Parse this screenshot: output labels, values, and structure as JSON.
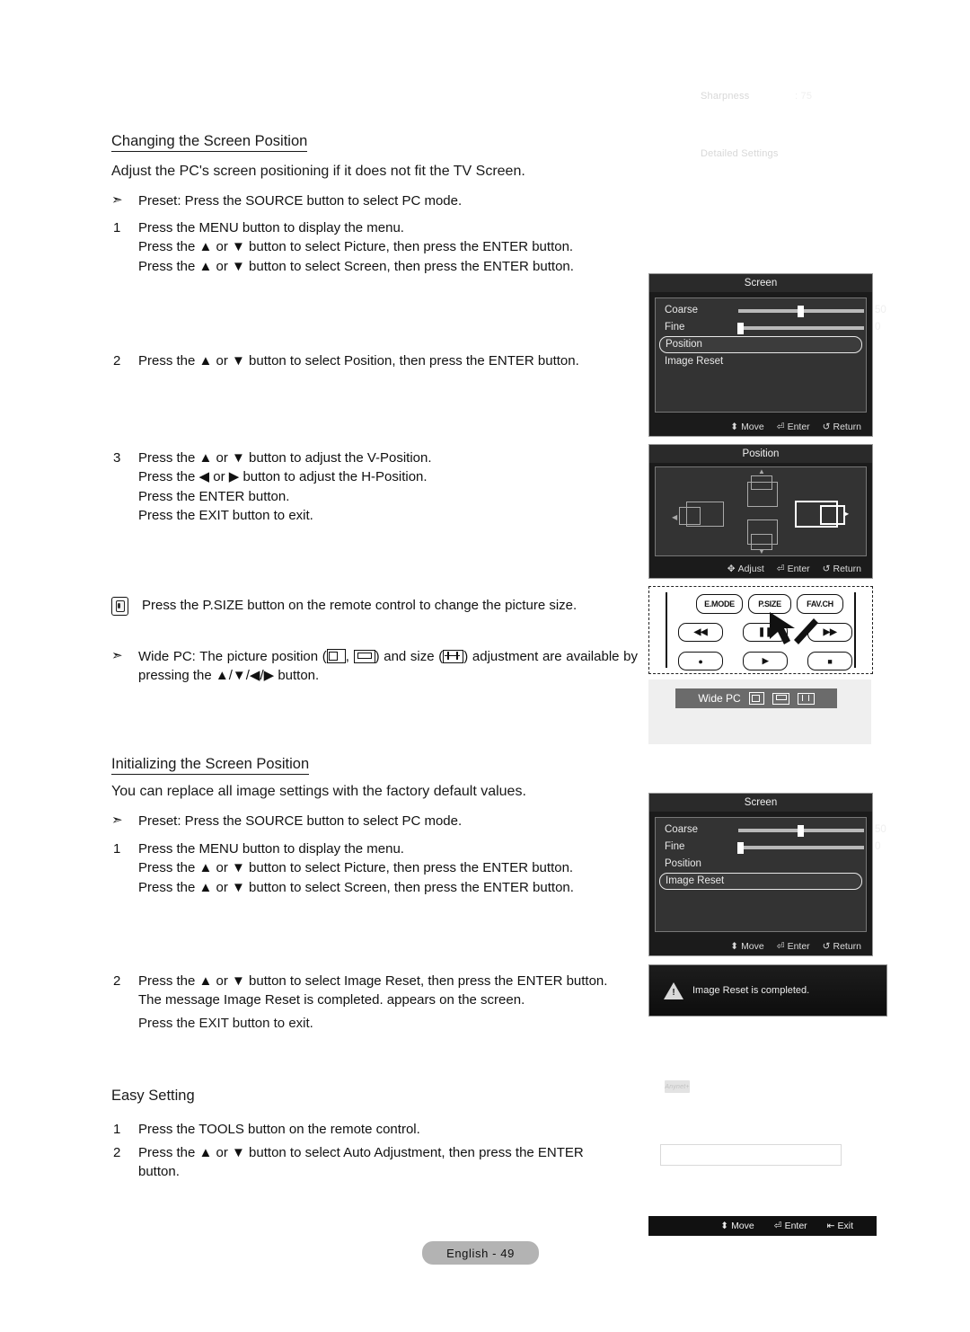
{
  "ghost": {
    "sharpness_label": "Sharpness",
    "sharpness_value": ": 75",
    "detailed_settings": "Detailed Settings",
    "anynet_badge": "Anynet+"
  },
  "section1": {
    "title": "Changing the Screen Position",
    "lead": "Adjust the PC's screen positioning if it does not fit the TV Screen.",
    "preset_bullet": "Preset: Press the SOURCE button to select PC mode.",
    "steps": [
      {
        "num": "1",
        "lines": [
          "Press the MENU button to display the menu.",
          "Press the ▲ or ▼ button to select Picture, then press the ENTER button.",
          "Press the ▲ or ▼ button to select Screen, then press the ENTER button."
        ]
      },
      {
        "num": "2",
        "lines": [
          "Press the ▲ or ▼ button to select Position, then press the ENTER button."
        ]
      },
      {
        "num": "3",
        "lines": [
          "Press the ▲ or ▼ button to adjust the V-Position.",
          "Press the ◀ or ▶ button to adjust the H-Position.",
          "Press the ENTER button.",
          "Press the EXIT button to exit."
        ]
      }
    ],
    "note": "Press the P.SIZE button on the remote control to change the picture size.",
    "widepc_bullet": {
      "part1": "Wide PC: The picture position (",
      "part2": ", ",
      "part3": ") and size (",
      "part4": ") adjustment are available by",
      "line2": "pressing the ▲/▼/◀/▶ button."
    }
  },
  "section2": {
    "title": "Initializing the Screen Position",
    "lead": "You can replace all image settings with the factory default values.",
    "preset_bullet": "Preset: Press the SOURCE button to select PC mode.",
    "steps": [
      {
        "num": "1",
        "lines": [
          "Press the MENU button to display the menu.",
          "Press the ▲ or ▼ button to select Picture, then press the ENTER button.",
          "Press the ▲ or ▼ button to select Screen, then press the ENTER button."
        ]
      },
      {
        "num": "2",
        "lines": [
          "Press the ▲ or ▼ button to select Image Reset, then press the ENTER button.",
          "The message Image Reset is completed. appears on the screen."
        ]
      }
    ],
    "exit_line": "Press the EXIT button to exit."
  },
  "section3": {
    "title": "Easy Setting",
    "steps": [
      {
        "num": "1",
        "lines": [
          "Press the TOOLS button on the remote control."
        ]
      },
      {
        "num": "2",
        "lines": [
          "Press the ▲ or ▼ button to select Auto Adjustment, then press the ENTER",
          "button."
        ]
      }
    ]
  },
  "osd_screen_1": {
    "title": "Screen",
    "rows": [
      {
        "label": "Coarse",
        "value": "50",
        "slider": 50
      },
      {
        "label": "Fine",
        "value": "0",
        "slider": 0
      },
      {
        "label": "Position",
        "value": "",
        "selected": true
      },
      {
        "label": "Image Reset",
        "value": ""
      }
    ],
    "footer": [
      {
        "icon": "updown-arrow-icon",
        "glyph": "⬍",
        "label": "Move"
      },
      {
        "icon": "enter-icon",
        "glyph": "⏎",
        "label": "Enter"
      },
      {
        "icon": "return-icon",
        "glyph": "↺",
        "label": "Return"
      }
    ]
  },
  "osd_position": {
    "title": "Position",
    "icons": [
      {
        "name": "position-left-icon",
        "direction": "left",
        "selected": false
      },
      {
        "name": "position-up-icon",
        "direction": "up",
        "selected": false
      },
      {
        "name": "position-right-icon",
        "direction": "right",
        "selected": true
      },
      {
        "name": "position-down-icon",
        "direction": "down",
        "selected": false
      }
    ],
    "footer": [
      {
        "icon": "adjust-arrows-icon",
        "glyph": "✥",
        "label": "Adjust"
      },
      {
        "icon": "enter-icon",
        "glyph": "⏎",
        "label": "Enter"
      },
      {
        "icon": "return-icon",
        "glyph": "↺",
        "label": "Return"
      }
    ]
  },
  "remote": {
    "top_buttons": [
      "E.MODE",
      "P.SIZE",
      "FAV.CH"
    ],
    "mid_buttons": [
      "◀◀",
      "❚❚",
      "▶▶"
    ],
    "bottom_buttons": [
      "●",
      "▶",
      "■"
    ],
    "pointer": "cursor-arrow-icon"
  },
  "widepc_card": {
    "label": "Wide PC",
    "icons": [
      "position-v-icon",
      "position-h-icon",
      "size-icon"
    ]
  },
  "osd_screen_2": {
    "title": "Screen",
    "rows": [
      {
        "label": "Coarse",
        "value": "50",
        "slider": 50
      },
      {
        "label": "Fine",
        "value": "0",
        "slider": 0
      },
      {
        "label": "Position",
        "value": ""
      },
      {
        "label": "Image Reset",
        "value": "",
        "selected": true
      }
    ],
    "footer": [
      {
        "icon": "updown-arrow-icon",
        "glyph": "⬍",
        "label": "Move"
      },
      {
        "icon": "enter-icon",
        "glyph": "⏎",
        "label": "Enter"
      },
      {
        "icon": "return-icon",
        "glyph": "↺",
        "label": "Return"
      }
    ]
  },
  "toast": {
    "icon": "warning-triangle-icon",
    "message": "Image Reset is completed."
  },
  "bottom_bar": [
    {
      "icon": "updown-arrow-icon",
      "glyph": "⬍",
      "label": "Move"
    },
    {
      "icon": "enter-icon",
      "glyph": "⏎",
      "label": "Enter"
    },
    {
      "icon": "exit-icon",
      "glyph": "⤒",
      "label": "Exit"
    }
  ],
  "page_footer": "English - 49"
}
